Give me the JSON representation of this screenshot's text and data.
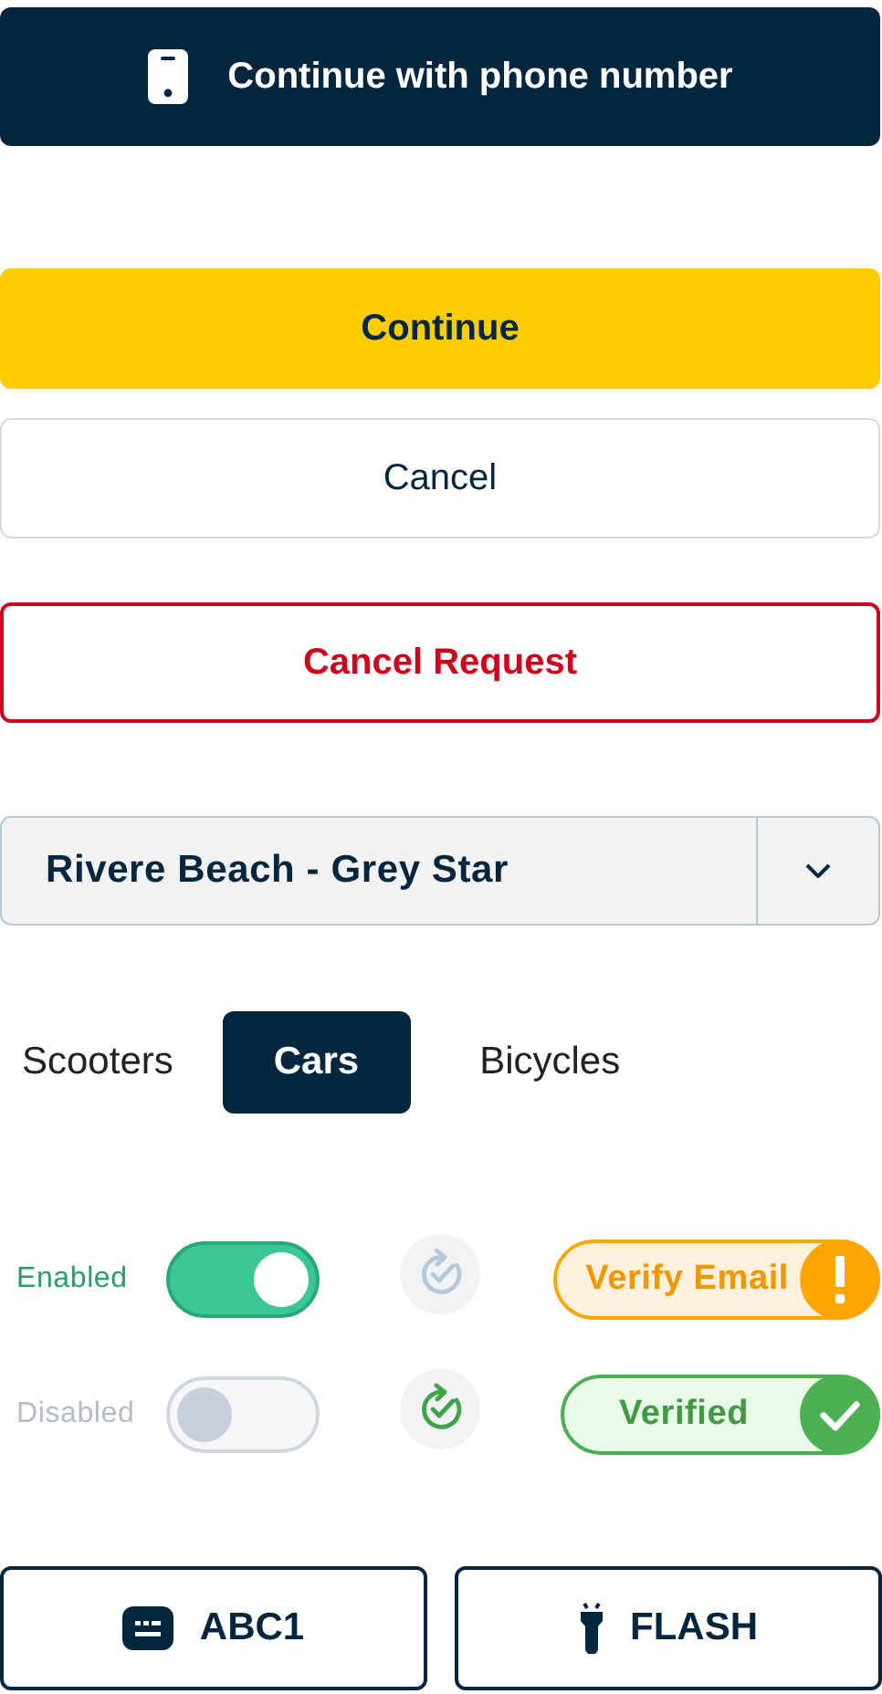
{
  "phone_button": {
    "label": "Continue with phone number"
  },
  "primary_button": {
    "label": "Continue"
  },
  "cancel_button": {
    "label": "Cancel"
  },
  "danger_button": {
    "label": "Cancel Request"
  },
  "location_select": {
    "value": "Rivere Beach - Grey Star"
  },
  "tabs": [
    {
      "label": "Scooters",
      "selected": false
    },
    {
      "label": "Cars",
      "selected": true
    },
    {
      "label": "Bicycles",
      "selected": false
    }
  ],
  "status_rows": [
    {
      "toggle_label": "Enabled",
      "on": true,
      "synced": false,
      "badge": {
        "label": "Verify Email",
        "kind": "warning"
      }
    },
    {
      "toggle_label": "Disabled",
      "on": false,
      "synced": true,
      "badge": {
        "label": "Verified",
        "kind": "success"
      }
    }
  ],
  "scan_buttons": [
    {
      "label": "ABC1",
      "kind": "keyboard"
    },
    {
      "label": "FLASH",
      "kind": "flashlight"
    }
  ]
}
